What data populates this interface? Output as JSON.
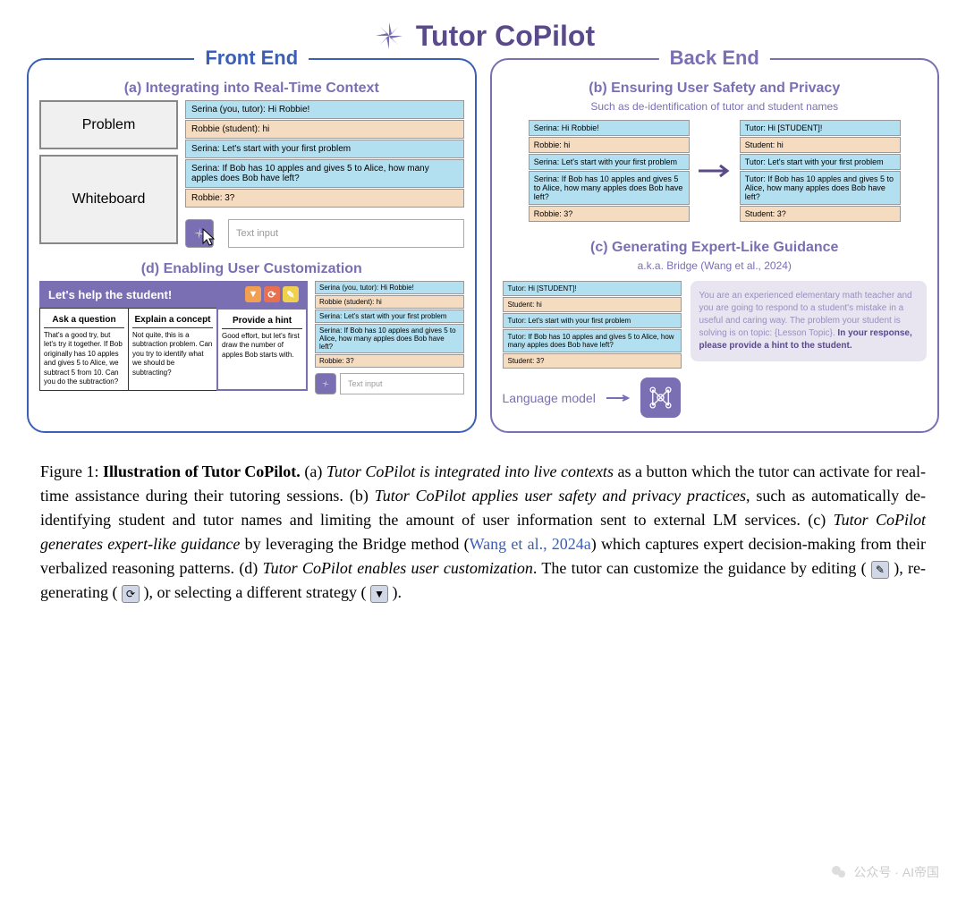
{
  "title": "Tutor CoPilot",
  "front_label": "Front End",
  "back_label": "Back End",
  "section_a": {
    "title": "(a) Integrating into Real-Time Context",
    "problem_label": "Problem",
    "whiteboard_label": "Whiteboard",
    "text_input": "Text input",
    "chat": [
      {
        "role": "tutor",
        "text": "Serina (you, tutor): Hi Robbie!"
      },
      {
        "role": "student",
        "text": "Robbie (student): hi"
      },
      {
        "role": "tutor",
        "text": "Serina: Let's start with your first problem"
      },
      {
        "role": "tutor",
        "text": "Serina: If Bob has 10 apples and gives 5 to Alice, how many apples does Bob have left?"
      },
      {
        "role": "student",
        "text": "Robbie: 3?"
      }
    ]
  },
  "section_b": {
    "title": "(b) Ensuring User Safety and Privacy",
    "subtitle": "Such as de-identification of tutor and student names",
    "chat_left": [
      {
        "role": "tutor",
        "text": "Serina: Hi Robbie!"
      },
      {
        "role": "student",
        "text": "Robbie: hi"
      },
      {
        "role": "tutor",
        "text": "Serina: Let's start with your first problem"
      },
      {
        "role": "tutor",
        "text": "Serina: If Bob has 10 apples and gives 5 to Alice, how many apples does Bob have left?"
      },
      {
        "role": "student",
        "text": "Robbie: 3?"
      }
    ],
    "chat_right": [
      {
        "role": "tutor",
        "text": "Tutor: Hi [STUDENT]!"
      },
      {
        "role": "student",
        "text": "Student: hi"
      },
      {
        "role": "tutor",
        "text": "Tutor: Let's start with your first problem"
      },
      {
        "role": "tutor",
        "text": "Tutor: If Bob has 10 apples and gives 5 to Alice, how many apples does Bob have left?"
      },
      {
        "role": "student",
        "text": "Student: 3?"
      }
    ]
  },
  "section_c": {
    "title": "(c) Generating Expert-Like Guidance",
    "subtitle": "a.k.a. Bridge (Wang et al., 2024)",
    "chat": [
      {
        "role": "tutor",
        "text": "Tutor: Hi [STUDENT]!"
      },
      {
        "role": "student",
        "text": "Student: hi"
      },
      {
        "role": "tutor",
        "text": "Tutor: Let's start with your first problem"
      },
      {
        "role": "tutor",
        "text": "Tutor: If Bob has 10 apples and gives 5 to Alice, how many apples does Bob have left?"
      },
      {
        "role": "student",
        "text": "Student: 3?"
      }
    ],
    "prompt_gray": "You are an experienced elementary math teacher and you are going to respond to a student's mistake in a useful and caring way. The problem your student is solving is on topic: {Lesson Topic}. ",
    "prompt_bold": "In your response, please provide a hint to the student.",
    "lang_model": "Language model"
  },
  "section_d": {
    "title": "(d) Enabling User Customization",
    "header": "Let's help the student!",
    "cols": [
      {
        "title": "Ask a question",
        "text": "That's a good try, but let's try it together. If Bob originally has 10 apples and gives 5 to Alice, we subtract 5 from 10. Can you do the subtraction?"
      },
      {
        "title": "Explain a concept",
        "text": "Not quite, this is a subtraction problem. Can you try to identify what we should be subtracting?"
      },
      {
        "title": "Provide a hint",
        "text": "Good effort, but let's first draw the number of apples Bob starts with."
      }
    ],
    "text_input": "Text input",
    "chat": [
      {
        "role": "tutor",
        "text": "Serina (you, tutor): Hi Robbie!"
      },
      {
        "role": "student",
        "text": "Robbie (student): hi"
      },
      {
        "role": "tutor",
        "text": "Serina: Let's start with your first problem"
      },
      {
        "role": "tutor",
        "text": "Serina: If Bob has 10 apples and gives 5 to Alice, how many apples does Bob have left?"
      },
      {
        "role": "student",
        "text": "Robbie: 3?"
      }
    ]
  },
  "caption": {
    "fig_label": "Figure 1: ",
    "fig_title": "Illustration of Tutor CoPilot.",
    "part_a": " (a) ",
    "part_a_italic": "Tutor CoPilot is integrated into live contexts",
    "part_a_rest": " as a button which the tutor can activate for real-time assistance during their tutoring sessions. (b) ",
    "part_b_italic": "Tutor CoPilot applies user safety and privacy practices",
    "part_b_rest": ", such as automatically de-identifying student and tutor names and limiting the amount of user information sent to external LM services. (c) ",
    "part_c_italic": "Tutor CoPilot generates expert-like guidance",
    "part_c_rest": " by leveraging the Bridge method (",
    "citation": "Wang et al., 2024a",
    "part_c_rest2": ") which captures expert decision-making from their verbalized reasoning patterns. (d) ",
    "part_d_italic": "Tutor CoPilot enables user customization",
    "part_d_rest": ". The tutor can customize the guidance by editing ( ",
    "part_d_rest2": " ), re-generating ( ",
    "part_d_rest3": " ), or selecting a different strategy ( ",
    "part_d_rest4": " )."
  },
  "watermark": "公众号 · AI帝国"
}
